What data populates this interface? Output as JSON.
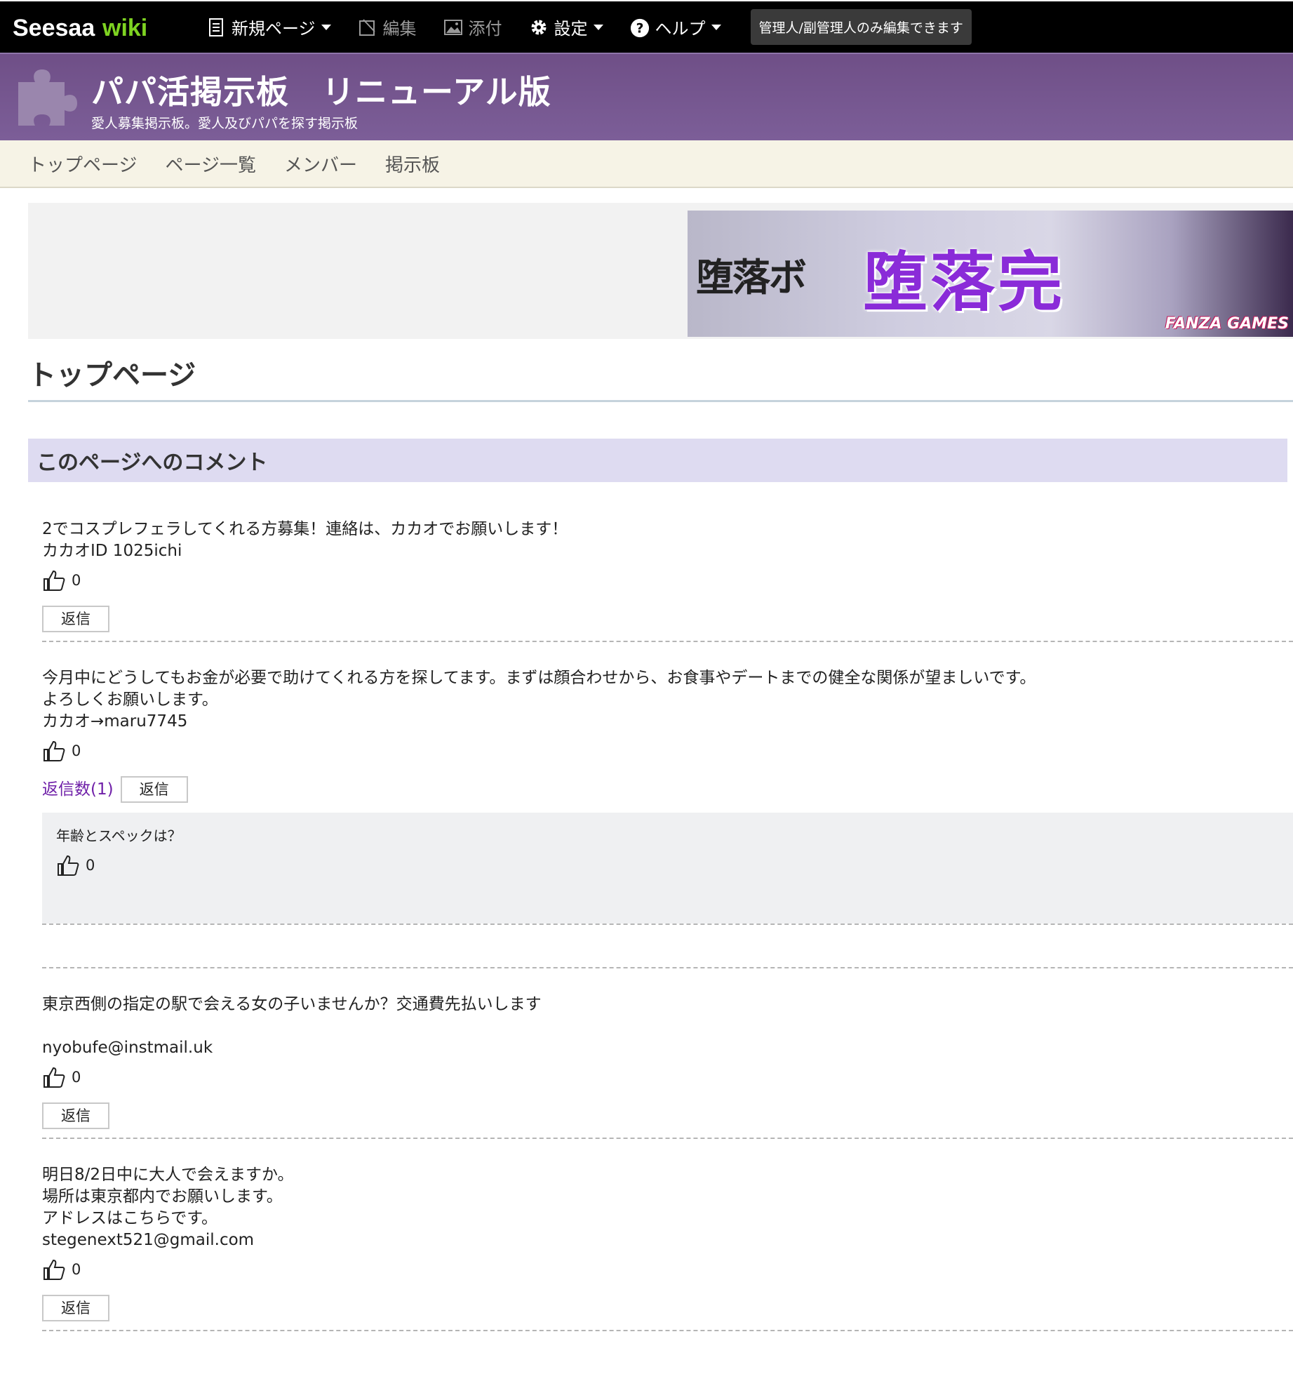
{
  "topbar": {
    "logo_text": "Seesaa wiki",
    "menu": [
      {
        "label": "新規ページ",
        "icon": "document-icon"
      },
      {
        "label": "編集",
        "icon": "edit-icon"
      },
      {
        "label": "添付",
        "icon": "image-icon"
      },
      {
        "label": "設定",
        "icon": "gear-icon"
      },
      {
        "label": "ヘルプ",
        "icon": "help-icon"
      }
    ],
    "notice": "管理人/副管理人のみ編集できます"
  },
  "header": {
    "title": "パパ活掲示板　リニューアル版",
    "subtitle": "愛人募集掲示板。愛人及びパパを探す掲示板"
  },
  "nav": [
    "トップページ",
    "ページ一覧",
    "メンバー",
    "掲示板"
  ],
  "banner": {
    "main_text": "堕落完",
    "brand": "FANZA GAMES",
    "logo_text": "堕落ボ"
  },
  "page_title": "トップページ",
  "comment_section_title": "このページへのコメント",
  "comments": [
    {
      "lines": [
        "2でコスプレフェラしてくれる方募集！連絡は、カカオでお願いします！",
        "カカオID 1025ichi"
      ],
      "likes": "0",
      "reply_label": "返信"
    },
    {
      "lines": [
        "今月中にどうしてもお金が必要で助けてくれる方を探してます。まずは顔合わせから、お食事やデートまでの健全な関係が望ましいです。",
        "よろしくお願いします。",
        "カカオ→maru7745"
      ],
      "likes": "0",
      "reply_count_label": "返信数(1)",
      "reply_label": "返信",
      "reply": {
        "text": "年齢とスペックは？",
        "likes": "0"
      }
    },
    {
      "lines": [
        "東京西側の指定の駅で会える女の子いませんか？交通費先払いします",
        "",
        "nyobufe@instmail.uk"
      ],
      "likes": "0",
      "reply_label": "返信"
    },
    {
      "lines": [
        "明日8/2日中に大人で会えますか。",
        "場所は東京都内でお願いします。",
        "アドレスはこちらです。",
        "stegenext521@gmail.com"
      ],
      "likes": "0",
      "reply_label": "返信"
    }
  ]
}
